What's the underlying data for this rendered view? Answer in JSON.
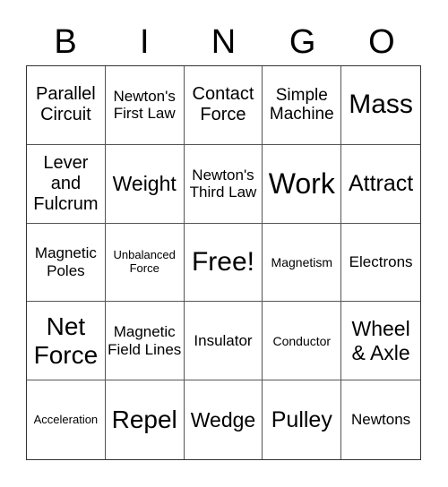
{
  "header": [
    "B",
    "I",
    "N",
    "G",
    "O"
  ],
  "cells": [
    "Parallel Circuit",
    "Newton's First Law",
    "Contact Force",
    "Simple Machine",
    "Mass",
    "Lever and Fulcrum",
    "Weight",
    "Newton's Third Law",
    "Work",
    "Attract",
    "Magnetic Poles",
    "Unbalanced Force",
    "Free!",
    "Magnetism",
    "Electrons",
    "Net Force",
    "Magnetic Field Lines",
    "Insulator",
    "Conductor",
    "Wheel & Axle",
    "Acceleration",
    "Repel",
    "Wedge",
    "Pulley",
    "Newtons"
  ]
}
